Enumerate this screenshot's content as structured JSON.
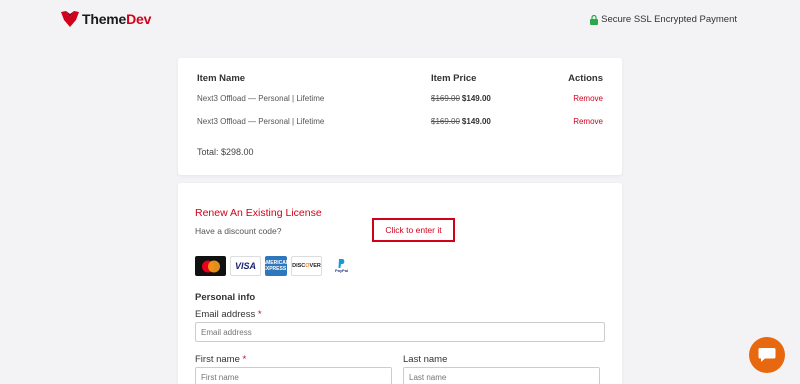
{
  "header": {
    "logo_text_a": "Theme",
    "logo_text_b": "Dev",
    "secure_label": "Secure SSL Encrypted Payment"
  },
  "cart": {
    "headers": {
      "name": "Item Name",
      "price": "Item Price",
      "actions": "Actions"
    },
    "items": [
      {
        "name": "Next3 Offload — Personal | Lifetime",
        "old_price": "$169.00",
        "price": "$149.00",
        "action": "Remove"
      },
      {
        "name": "Next3 Offload — Personal | Lifetime",
        "old_price": "$169.00",
        "price": "$149.00",
        "action": "Remove"
      }
    ],
    "total": "Total: $298.00"
  },
  "form": {
    "renew_link": "Renew An Existing License",
    "discount_label": "Have a discount code?",
    "discount_button": "Click to enter it",
    "payment_icons": [
      "mastercard-icon",
      "visa-icon",
      "amex-icon",
      "discover-icon",
      "paypal-icon"
    ],
    "card_labels": {
      "visa": "VISA",
      "amex": "AMERICAN EXPRESS",
      "discover_a": "DISC",
      "discover_b": "O",
      "discover_c": "VER",
      "paypal": "PayPal"
    },
    "section_title": "Personal info",
    "email": {
      "label": "Email address",
      "required": "*",
      "placeholder": "Email address"
    },
    "first_name": {
      "label": "First name",
      "required": "*",
      "placeholder": "First name"
    },
    "last_name": {
      "label": "Last name",
      "placeholder": "Last name"
    }
  },
  "colors": {
    "accent": "#d0021b",
    "chat": "#e8680f",
    "secure": "#2aa84a"
  }
}
